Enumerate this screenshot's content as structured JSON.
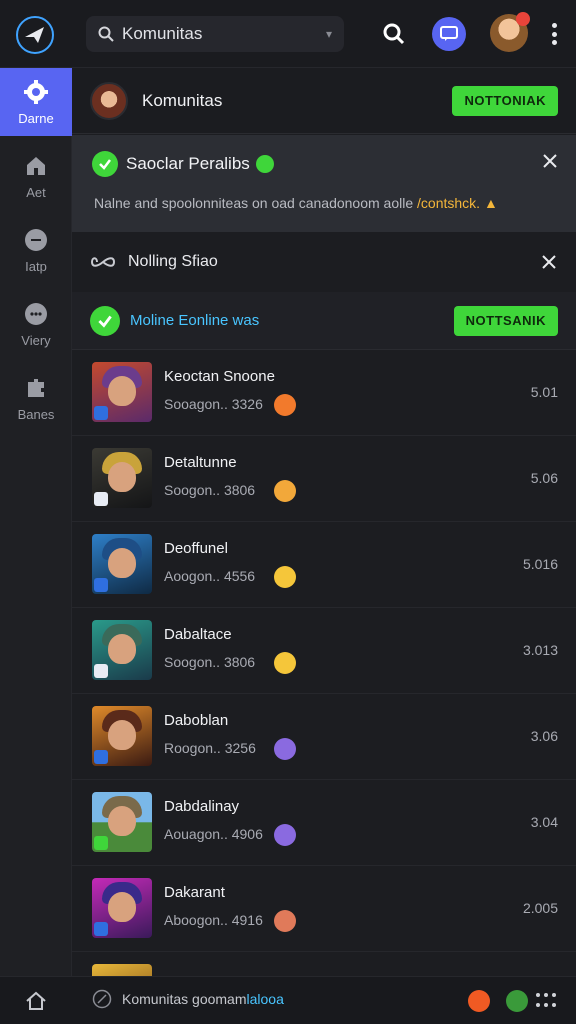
{
  "topbar": {
    "search_value": "Komunitas"
  },
  "sidebar": {
    "items": [
      {
        "label": "Darne",
        "icon": "gear-icon"
      },
      {
        "label": "Aet",
        "icon": "home-icon"
      },
      {
        "label": "Iatp",
        "icon": "chat-icon"
      },
      {
        "label": "Viery",
        "icon": "message-icon"
      },
      {
        "label": "Banes",
        "icon": "puzzle-icon"
      }
    ]
  },
  "header": {
    "title": "Komunitas",
    "button_label": "NOTTONIAK"
  },
  "notice": {
    "title": "Saoclar Peralibs",
    "text_main": "Nalne and spoolonniteas on oad canadonoom aolle ",
    "text_highlight": "/contshck."
  },
  "follow": {
    "label": "Nolling Sfiao"
  },
  "live": {
    "label": "Moline Eonline was",
    "button_label": "NOTTSANIK"
  },
  "list": [
    {
      "title": "Keoctan Snoone",
      "sub": "Sooagon.. 3326",
      "value": "5.01"
    },
    {
      "title": "Detaltunne",
      "sub": "Soogon.. 3806",
      "value": "5.06"
    },
    {
      "title": "Deoffunel",
      "sub": "Aoogon.. 4556",
      "value": "5.016"
    },
    {
      "title": "Dabaltace",
      "sub": "Soogon.. 3806",
      "value": "3.013"
    },
    {
      "title": "Daboblan",
      "sub": "Roogon.. 3256",
      "value": "3.06"
    },
    {
      "title": "Dabdalinay",
      "sub": "Aouagon.. 4906",
      "value": "3.04"
    },
    {
      "title": "Dakarant",
      "sub": "Aboogon.. 4916",
      "value": "2.005"
    }
  ],
  "bottombar": {
    "status_main": "Komunitas goomam",
    "status_highlight": "lalooa"
  },
  "colors": {
    "accent": "#5865f2",
    "green": "#3fd63a",
    "link": "#49c5ff",
    "highlight": "#f4b63a"
  }
}
